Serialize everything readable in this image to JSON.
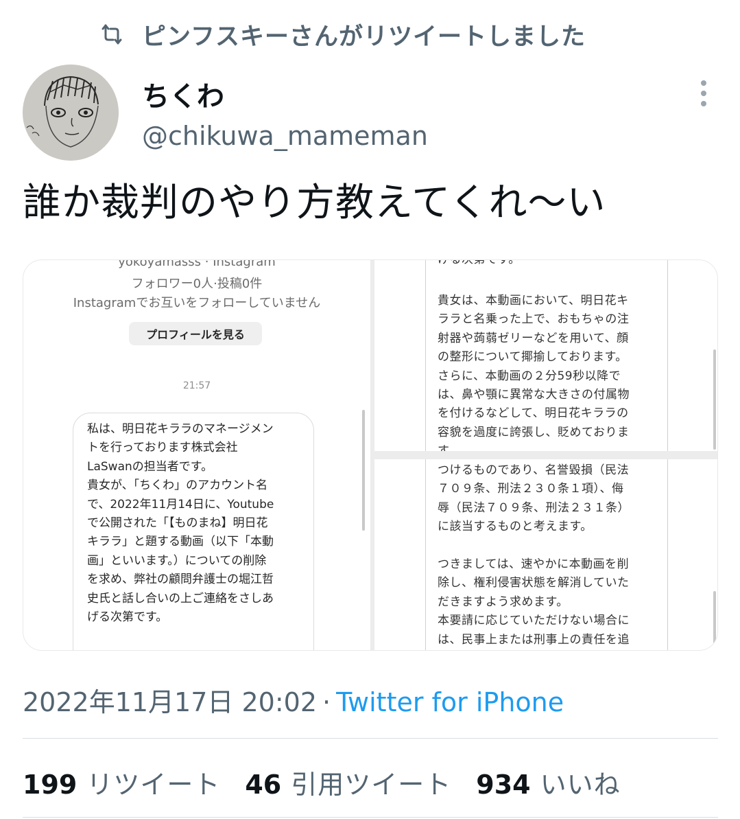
{
  "retweet_context": {
    "label": "ピンフスキーさんがリツイートしました"
  },
  "author": {
    "display_name": "ちくわ",
    "handle": "@chikuwa_mameman"
  },
  "tweet": {
    "text": "誰か裁判のやり方教えてくれ〜い"
  },
  "media": {
    "image1": {
      "account_name": "yokoyamasss · Instagram",
      "followers": "フォロワー0人·投稿0件",
      "follow_status": "Instagramでお互いをフォローしていません",
      "profile_button": "プロフィールを見る",
      "time": "21:57",
      "message": "私は、明日花キララのマネージメン\nトを行っております株式会社\nLaSwanの担当者です。\n貴女が、「ちくわ」のアカウント名\nで、2022年11月14日に、Youtube\nで公開された「【ものまね】明日花\nキララ」と題する動画（以下「本動\n画」といいます。）についての削除\nを求め、弊社の顧問弁護士の堀江哲\n史氏と話し合いの上ご連絡をさしあ\nげる次第です。"
    },
    "image2": {
      "partial_top": "げる次第です。",
      "text": "貴女は、本動画において、明日花キ\nララと名乗った上で、おもちゃの注\n射器や蒟蒻ゼリーなどを用いて、顔\nの整形について揶揄しております。\nさらに、本動画の２分59秒以降で\nは、鼻や顎に異常な大きさの付属物\nを付けるなどして、明日花キララの\n容貌を過度に誇張し、貶めておりま\nす。"
    },
    "image3": {
      "text": "つけるものであり、名誉毀損（民法\n７０９条、刑法２３０条１項）、侮\n辱（民法７０９条、刑法２３１条）\nに該当するものと考えます。\n\nつきましては、速やかに本動画を削\n除し、権利侵害状態を解消していた\nだきますよう求めます。\n本要請に応じていただけない場合に\nは、民事上または刑事上の責任を追"
    }
  },
  "meta": {
    "date": "2022年11月17日 20:02",
    "separator": "·",
    "source": "Twitter for iPhone"
  },
  "stats": {
    "retweets": {
      "count": "199",
      "label": "リツイート"
    },
    "quotes": {
      "count": "46",
      "label": "引用ツイート"
    },
    "likes": {
      "count": "934",
      "label": "いいね"
    }
  },
  "colors": {
    "text_primary": "#0f1419",
    "text_secondary": "#536471",
    "link": "#1d9bf0",
    "divider": "#d9dfe3"
  },
  "icons": {
    "retweet": "retweet-icon",
    "more": "more-icon",
    "avatar": "avatar-sketch"
  }
}
